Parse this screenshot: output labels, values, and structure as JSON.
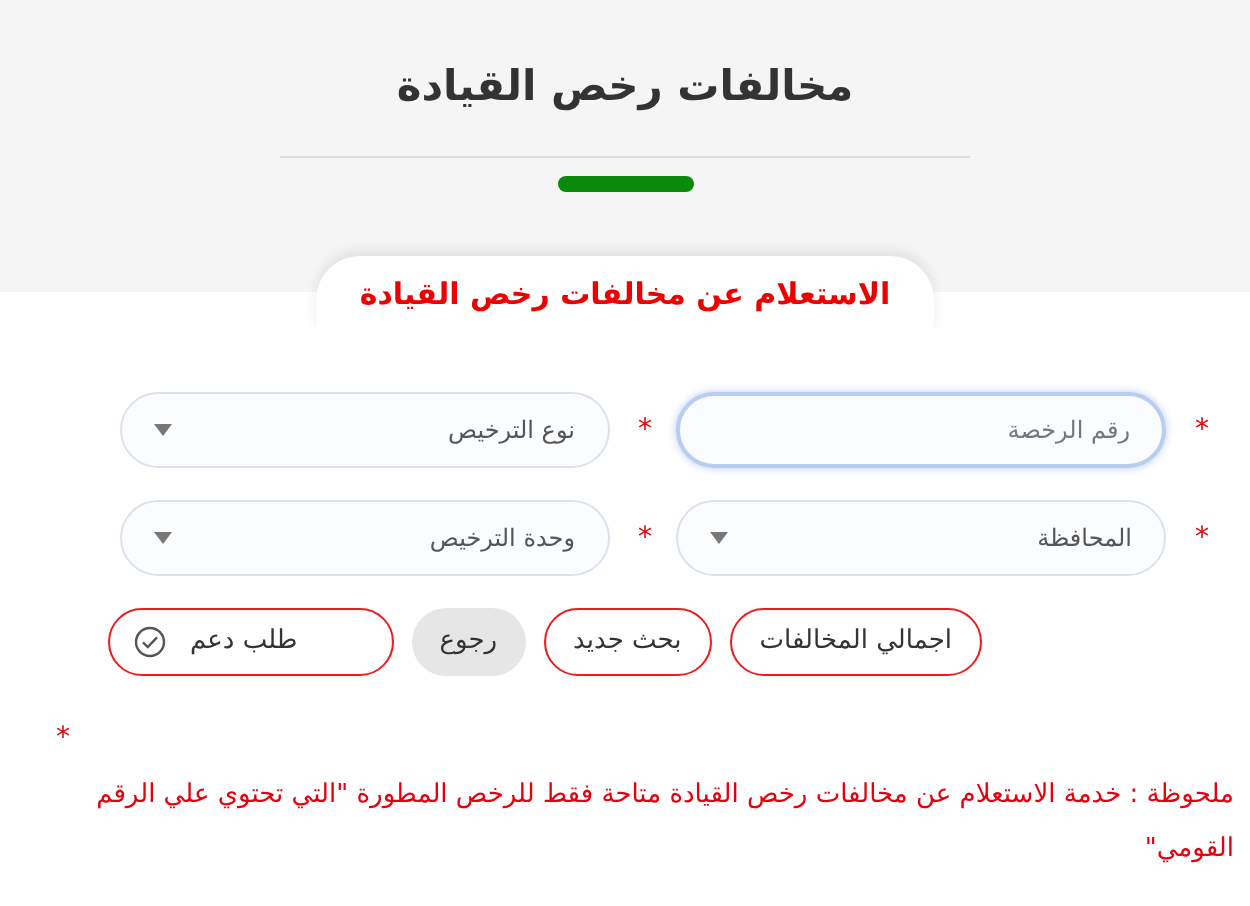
{
  "header": {
    "title": "مخالفات رخص القيادة"
  },
  "tab": {
    "label": "الاستعلام عن مخالفات رخص القيادة",
    "selected": true
  },
  "fields": [
    {
      "kind": "text",
      "placeholder": "رقم الرخصة",
      "required": "*",
      "focused": true
    },
    {
      "kind": "select",
      "value": "نوع الترخيص",
      "required": "*",
      "focused": false
    },
    {
      "kind": "select",
      "value": "المحافظة",
      "required": "*",
      "focused": false
    },
    {
      "kind": "select",
      "value": "وحدة الترخيص",
      "required": "*",
      "focused": false
    }
  ],
  "buttons": [
    {
      "kind": "outline",
      "label": "اجمالي المخالفات"
    },
    {
      "kind": "outline",
      "label": "بحث جديد"
    },
    {
      "kind": "filled",
      "label": "رجوع"
    },
    {
      "kind": "support",
      "label": "طلب دعم"
    }
  ],
  "note": {
    "mark": "*",
    "text": "ملحوظة : خدمة الاستعلام عن مخالفات رخص القيادة متاحة فقط للرخص المطورة \"التي تحتوي علي الرقم القومي\""
  }
}
